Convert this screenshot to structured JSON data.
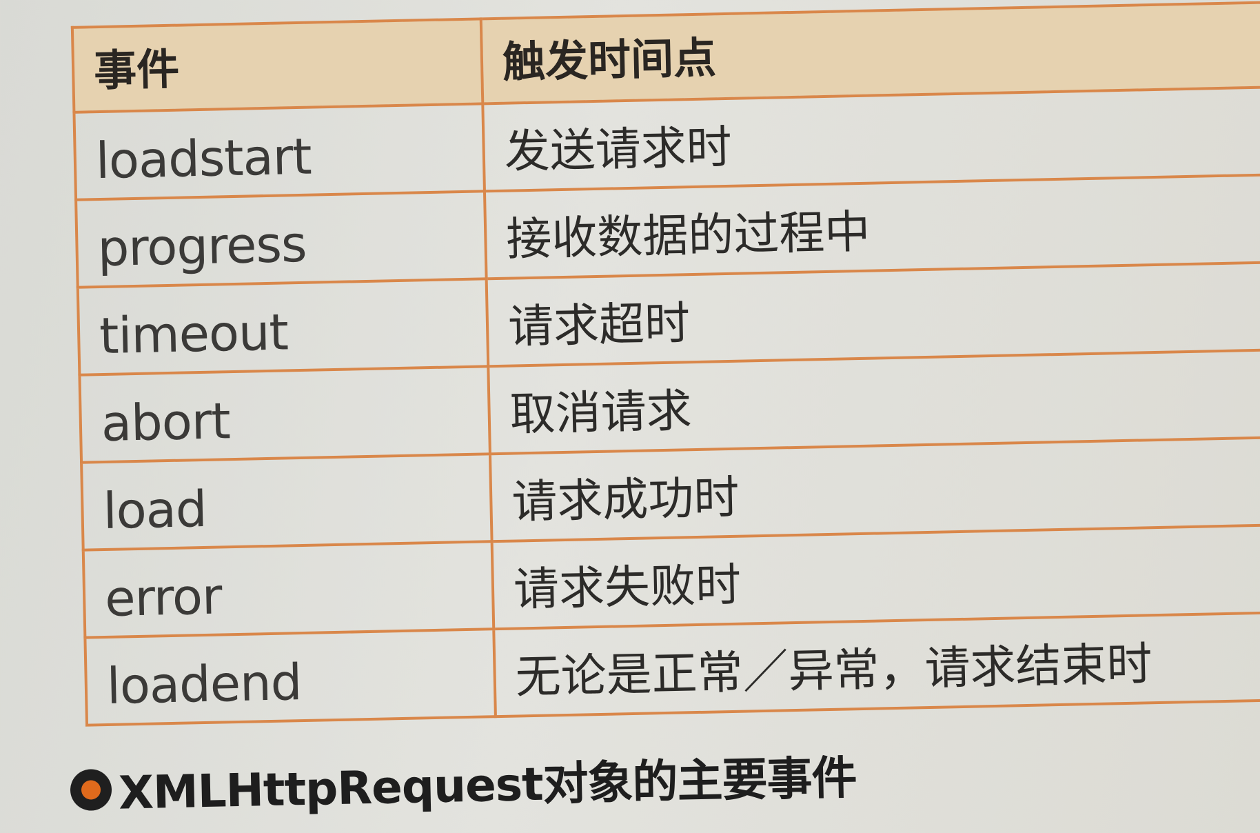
{
  "table": {
    "headers": [
      "事件",
      "触发时间点"
    ],
    "rows": [
      {
        "event": "loadstart",
        "timing": "发送请求时"
      },
      {
        "event": "progress",
        "timing": "接收数据的过程中"
      },
      {
        "event": "timeout",
        "timing": "请求超时"
      },
      {
        "event": "abort",
        "timing": "取消请求"
      },
      {
        "event": "load",
        "timing": "请求成功时"
      },
      {
        "event": "error",
        "timing": "请求失败时"
      },
      {
        "event": "loadend",
        "timing": "无论是正常／异常，请求结束时"
      }
    ]
  },
  "caption": {
    "text": "XMLHttpRequest对象的主要事件"
  },
  "colors": {
    "border": "#d9874a",
    "header_bg": "#e6d2b0",
    "bullet_accent": "#e06a1c"
  }
}
